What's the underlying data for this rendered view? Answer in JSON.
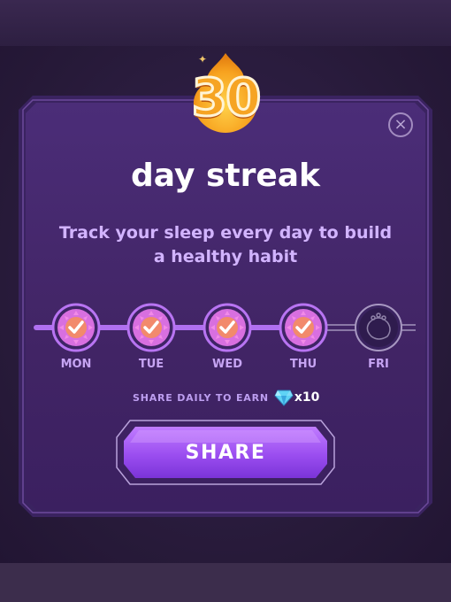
{
  "streak": {
    "count": "30",
    "title": "day streak",
    "subtitle": "Track your sleep every day to build a healthy habit"
  },
  "days": [
    {
      "label": "MON",
      "completed": true
    },
    {
      "label": "TUE",
      "completed": true
    },
    {
      "label": "WED",
      "completed": true
    },
    {
      "label": "THU",
      "completed": true
    },
    {
      "label": "FRI",
      "completed": false
    }
  ],
  "reward": {
    "text": "SHARE DAILY TO EARN",
    "count": "x10",
    "icon": "gem-icon"
  },
  "share_button": {
    "label": "SHARE"
  },
  "close_button": {
    "label": "×"
  },
  "colors": {
    "accent": "#a866f0",
    "flame": "#f6a423",
    "panel": "#422566",
    "subtitle": "#d2b4ff"
  }
}
